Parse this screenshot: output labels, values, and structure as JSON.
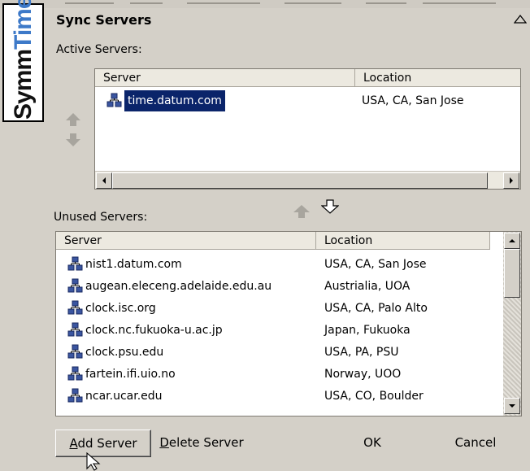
{
  "logo": {
    "text_main": "Symm",
    "text_accent": "Time",
    "superscript": "®"
  },
  "title": "Sync Servers",
  "active": {
    "label": "Active Servers:",
    "columns": [
      "Server",
      "Location"
    ],
    "rows": [
      {
        "server": "time.datum.com",
        "location": "USA, CA, San Jose",
        "selected": true
      }
    ]
  },
  "unused": {
    "label": "Unused Servers:",
    "columns": [
      "Server",
      "Location"
    ],
    "rows": [
      {
        "server": "nist1.datum.com",
        "location": "USA, CA, San Jose"
      },
      {
        "server": "augean.eleceng.adelaide.edu.au",
        "location": "Austrialia, UOA"
      },
      {
        "server": "clock.isc.org",
        "location": "USA, CA, Palo Alto"
      },
      {
        "server": "clock.nc.fukuoka-u.ac.jp",
        "location": "Japan, Fukuoka"
      },
      {
        "server": "clock.psu.edu",
        "location": "USA, PA, PSU"
      },
      {
        "server": "fartein.ifi.uio.no",
        "location": "Norway, UOO"
      },
      {
        "server": "ncar.ucar.edu",
        "location": "USA, CO, Boulder"
      }
    ]
  },
  "buttons": {
    "add_mnemonic": "A",
    "add_rest": "dd Server",
    "delete_mnemonic": "D",
    "delete_rest": "elete Server",
    "ok": "OK",
    "cancel": "Cancel"
  },
  "colors": {
    "selection": "#0a246a",
    "accent": "#3d79c8",
    "dialog_bg": "#d4d0c8"
  },
  "icons": [
    "server-icon",
    "up-arrow-icon",
    "down-arrow-icon",
    "collapse-icon",
    "mouse-cursor-icon"
  ]
}
